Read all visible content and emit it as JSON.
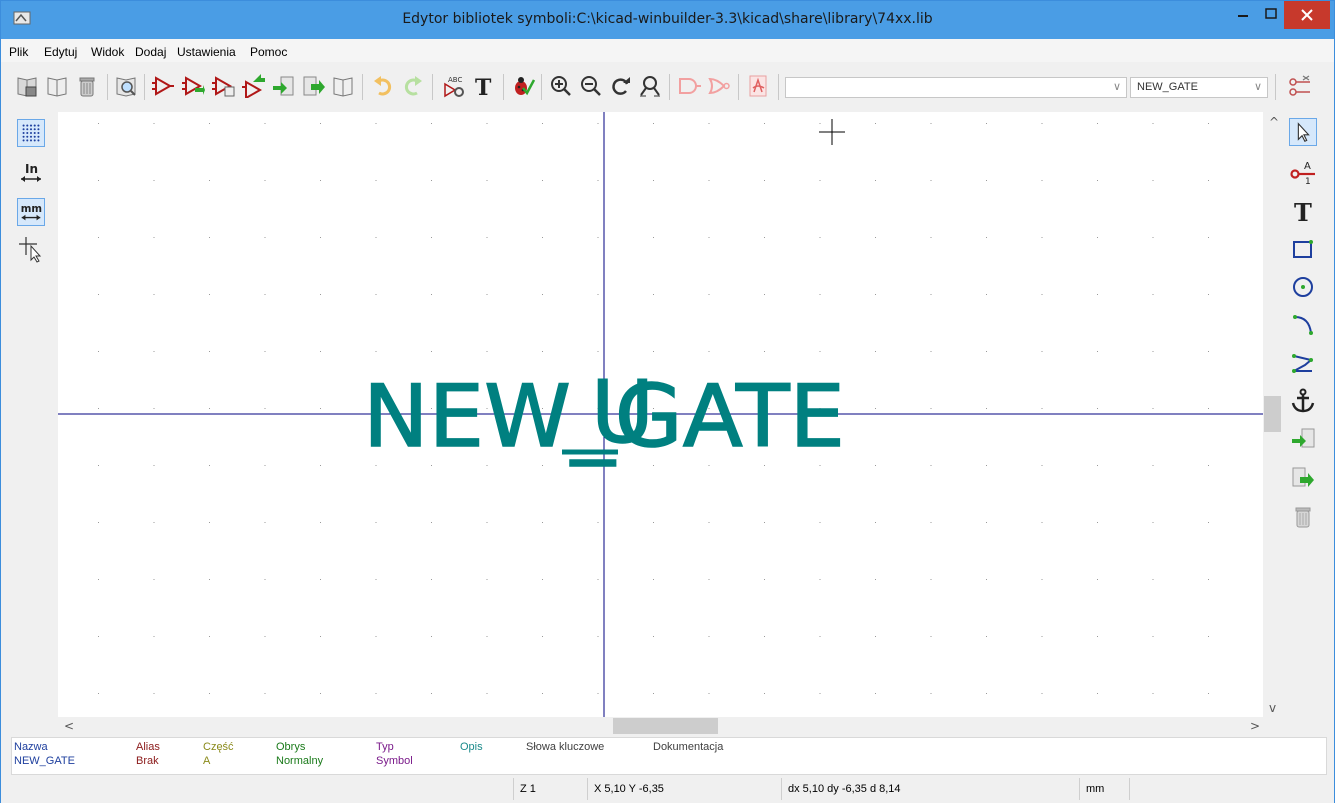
{
  "window": {
    "title": "Edytor bibliotek symboli:C:\\kicad-winbuilder-3.3\\kicad\\share\\library\\74xx.lib",
    "min_glyph": "–",
    "max_glyph": "□",
    "close_glyph": "×"
  },
  "menu": [
    "Plik",
    "Edytuj",
    "Widok",
    "Dodaj",
    "Ustawienia",
    "Pomoc"
  ],
  "toolbar": {
    "icons": [
      "save-library-icon",
      "new-library-icon",
      "delete-library-icon",
      "browse-symbols-icon",
      "new-symbol-icon",
      "load-symbol-icon",
      "save-symbol-icon",
      "import-symbol-icon",
      "export-symbol-icon",
      "copy-symbol-icon",
      "documentation-icon",
      "undo-icon",
      "redo-icon",
      "symbol-properties-icon",
      "text-icon",
      "erc-icon",
      "zoom-in-icon",
      "zoom-out-icon",
      "redraw-icon",
      "zoom-fit-icon",
      "normal-body-icon",
      "demorgan-body-icon",
      "pdf-icon"
    ],
    "part_combo_value": "",
    "alias_combo_value": "NEW_GATE",
    "combo_arrow": "∨",
    "pin_table_icon": "pin-table-icon"
  },
  "left_toolbar": {
    "inch_label": "In",
    "mm_label": "mm"
  },
  "canvas": {
    "reference_text": "U",
    "value_text": "NEW_GATE",
    "scroll_left": "<",
    "scroll_right": ">",
    "scroll_up": "^",
    "scroll_down": "v",
    "text_color": "#008080",
    "axis_color": "#000080"
  },
  "info": {
    "columns": [
      {
        "label": "Nazwa",
        "value": "NEW_GATE",
        "color": "#1e3f9e"
      },
      {
        "label": "Alias",
        "value": "Brak",
        "color": "#8b1a1a"
      },
      {
        "label": "Część",
        "value": "A",
        "color": "#8a8a1a"
      },
      {
        "label": "Obrys",
        "value": "Normalny",
        "color": "#1a7a1a"
      },
      {
        "label": "Typ",
        "value": "Symbol",
        "color": "#7a1a8a"
      },
      {
        "label": "Opis",
        "value": "",
        "color": "#1a8a8a"
      },
      {
        "label": "Słowa kluczowe",
        "value": "",
        "color": "#404040"
      },
      {
        "label": "Dokumentacja",
        "value": "",
        "color": "#404040"
      }
    ]
  },
  "status": {
    "zoom": "Z 1",
    "xy": "X 5,10  Y -6,35",
    "delta": "dx 5,10  dy -6,35  d 8,14",
    "units": "mm"
  }
}
